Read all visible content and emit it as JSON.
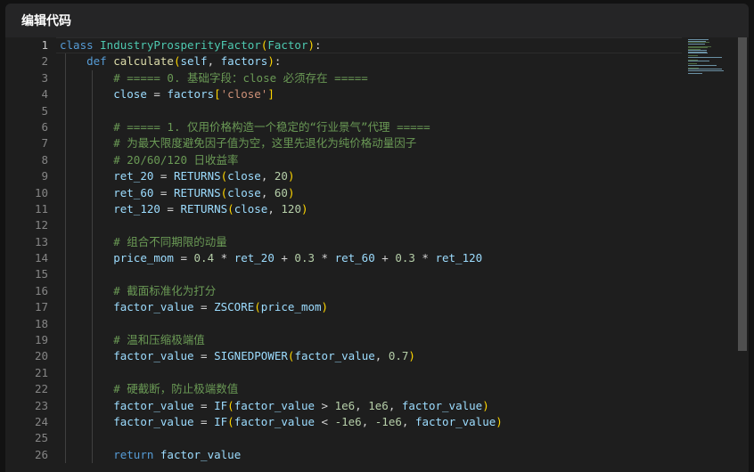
{
  "header": {
    "title": "编辑代码"
  },
  "editor": {
    "active_line": 1,
    "line_numbers": [
      "1",
      "2",
      "3",
      "4",
      "5",
      "6",
      "7",
      "8",
      "9",
      "10",
      "11",
      "12",
      "13",
      "14",
      "15",
      "16",
      "17",
      "18",
      "19",
      "20",
      "21",
      "22",
      "23",
      "24",
      "25",
      "26"
    ],
    "lines": [
      [
        {
          "t": "class ",
          "c": "kw"
        },
        {
          "t": "IndustryProsperityFactor",
          "c": "cls"
        },
        {
          "t": "(",
          "c": "br"
        },
        {
          "t": "Factor",
          "c": "cls"
        },
        {
          "t": ")",
          "c": "br"
        },
        {
          "t": ":",
          "c": "p"
        }
      ],
      [
        {
          "t": "    ",
          "c": "p"
        },
        {
          "t": "def ",
          "c": "kw"
        },
        {
          "t": "calculate",
          "c": "fn"
        },
        {
          "t": "(",
          "c": "br"
        },
        {
          "t": "self",
          "c": "var"
        },
        {
          "t": ", ",
          "c": "p"
        },
        {
          "t": "factors",
          "c": "var"
        },
        {
          "t": ")",
          "c": "br"
        },
        {
          "t": ":",
          "c": "p"
        }
      ],
      [
        {
          "t": "        ",
          "c": "p"
        },
        {
          "t": "# ===== 0. 基础字段：close 必须存在 =====",
          "c": "cm"
        }
      ],
      [
        {
          "t": "        ",
          "c": "p"
        },
        {
          "t": "close",
          "c": "var"
        },
        {
          "t": " = ",
          "c": "p"
        },
        {
          "t": "factors",
          "c": "var"
        },
        {
          "t": "[",
          "c": "br"
        },
        {
          "t": "'close'",
          "c": "str"
        },
        {
          "t": "]",
          "c": "br"
        }
      ],
      [],
      [
        {
          "t": "        ",
          "c": "p"
        },
        {
          "t": "# ===== 1. 仅用价格构造一个稳定的“行业景气”代理 =====",
          "c": "cm"
        }
      ],
      [
        {
          "t": "        ",
          "c": "p"
        },
        {
          "t": "# 为最大限度避免因子值为空，这里先退化为纯价格动量因子",
          "c": "cm"
        }
      ],
      [
        {
          "t": "        ",
          "c": "p"
        },
        {
          "t": "# 20/60/120 日收益率",
          "c": "cm"
        }
      ],
      [
        {
          "t": "        ",
          "c": "p"
        },
        {
          "t": "ret_20",
          "c": "var"
        },
        {
          "t": " = ",
          "c": "p"
        },
        {
          "t": "RETURNS",
          "c": "var"
        },
        {
          "t": "(",
          "c": "br"
        },
        {
          "t": "close",
          "c": "var"
        },
        {
          "t": ", ",
          "c": "p"
        },
        {
          "t": "20",
          "c": "num"
        },
        {
          "t": ")",
          "c": "br"
        }
      ],
      [
        {
          "t": "        ",
          "c": "p"
        },
        {
          "t": "ret_60",
          "c": "var"
        },
        {
          "t": " = ",
          "c": "p"
        },
        {
          "t": "RETURNS",
          "c": "var"
        },
        {
          "t": "(",
          "c": "br"
        },
        {
          "t": "close",
          "c": "var"
        },
        {
          "t": ", ",
          "c": "p"
        },
        {
          "t": "60",
          "c": "num"
        },
        {
          "t": ")",
          "c": "br"
        }
      ],
      [
        {
          "t": "        ",
          "c": "p"
        },
        {
          "t": "ret_120",
          "c": "var"
        },
        {
          "t": " = ",
          "c": "p"
        },
        {
          "t": "RETURNS",
          "c": "var"
        },
        {
          "t": "(",
          "c": "br"
        },
        {
          "t": "close",
          "c": "var"
        },
        {
          "t": ", ",
          "c": "p"
        },
        {
          "t": "120",
          "c": "num"
        },
        {
          "t": ")",
          "c": "br"
        }
      ],
      [],
      [
        {
          "t": "        ",
          "c": "p"
        },
        {
          "t": "# 组合不同期限的动量",
          "c": "cm"
        }
      ],
      [
        {
          "t": "        ",
          "c": "p"
        },
        {
          "t": "price_mom",
          "c": "var"
        },
        {
          "t": " = ",
          "c": "p"
        },
        {
          "t": "0.4",
          "c": "num"
        },
        {
          "t": " * ",
          "c": "p"
        },
        {
          "t": "ret_20",
          "c": "var"
        },
        {
          "t": " + ",
          "c": "p"
        },
        {
          "t": "0.3",
          "c": "num"
        },
        {
          "t": " * ",
          "c": "p"
        },
        {
          "t": "ret_60",
          "c": "var"
        },
        {
          "t": " + ",
          "c": "p"
        },
        {
          "t": "0.3",
          "c": "num"
        },
        {
          "t": " * ",
          "c": "p"
        },
        {
          "t": "ret_120",
          "c": "var"
        }
      ],
      [],
      [
        {
          "t": "        ",
          "c": "p"
        },
        {
          "t": "# 截面标准化为打分",
          "c": "cm"
        }
      ],
      [
        {
          "t": "        ",
          "c": "p"
        },
        {
          "t": "factor_value",
          "c": "var"
        },
        {
          "t": " = ",
          "c": "p"
        },
        {
          "t": "ZSCORE",
          "c": "var"
        },
        {
          "t": "(",
          "c": "br"
        },
        {
          "t": "price_mom",
          "c": "var"
        },
        {
          "t": ")",
          "c": "br"
        }
      ],
      [],
      [
        {
          "t": "        ",
          "c": "p"
        },
        {
          "t": "# 温和压缩极端值",
          "c": "cm"
        }
      ],
      [
        {
          "t": "        ",
          "c": "p"
        },
        {
          "t": "factor_value",
          "c": "var"
        },
        {
          "t": " = ",
          "c": "p"
        },
        {
          "t": "SIGNEDPOWER",
          "c": "var"
        },
        {
          "t": "(",
          "c": "br"
        },
        {
          "t": "factor_value",
          "c": "var"
        },
        {
          "t": ", ",
          "c": "p"
        },
        {
          "t": "0.7",
          "c": "num"
        },
        {
          "t": ")",
          "c": "br"
        }
      ],
      [],
      [
        {
          "t": "        ",
          "c": "p"
        },
        {
          "t": "# 硬截断，防止极端数值",
          "c": "cm"
        }
      ],
      [
        {
          "t": "        ",
          "c": "p"
        },
        {
          "t": "factor_value",
          "c": "var"
        },
        {
          "t": " = ",
          "c": "p"
        },
        {
          "t": "IF",
          "c": "var"
        },
        {
          "t": "(",
          "c": "br"
        },
        {
          "t": "factor_value",
          "c": "var"
        },
        {
          "t": " > ",
          "c": "p"
        },
        {
          "t": "1e6",
          "c": "num"
        },
        {
          "t": ", ",
          "c": "p"
        },
        {
          "t": "1e6",
          "c": "num"
        },
        {
          "t": ", ",
          "c": "p"
        },
        {
          "t": "factor_value",
          "c": "var"
        },
        {
          "t": ")",
          "c": "br"
        }
      ],
      [
        {
          "t": "        ",
          "c": "p"
        },
        {
          "t": "factor_value",
          "c": "var"
        },
        {
          "t": " = ",
          "c": "p"
        },
        {
          "t": "IF",
          "c": "var"
        },
        {
          "t": "(",
          "c": "br"
        },
        {
          "t": "factor_value",
          "c": "var"
        },
        {
          "t": " < ",
          "c": "p"
        },
        {
          "t": "-1e6",
          "c": "num"
        },
        {
          "t": ", ",
          "c": "p"
        },
        {
          "t": "-1e6",
          "c": "num"
        },
        {
          "t": ", ",
          "c": "p"
        },
        {
          "t": "factor_value",
          "c": "var"
        },
        {
          "t": ")",
          "c": "br"
        }
      ],
      [],
      [
        {
          "t": "        ",
          "c": "p"
        },
        {
          "t": "return ",
          "c": "kw"
        },
        {
          "t": "factor_value",
          "c": "var"
        }
      ]
    ]
  },
  "colors": {
    "keyword": "#569cd6",
    "class_name": "#4ec9b0",
    "function_name": "#dcdcaa",
    "variable": "#9cdcfe",
    "comment": "#6a9955",
    "number": "#b5cea8",
    "string": "#ce9178",
    "bracket": "#ffd700",
    "background": "#1e1e1e",
    "header_background": "#252526"
  }
}
